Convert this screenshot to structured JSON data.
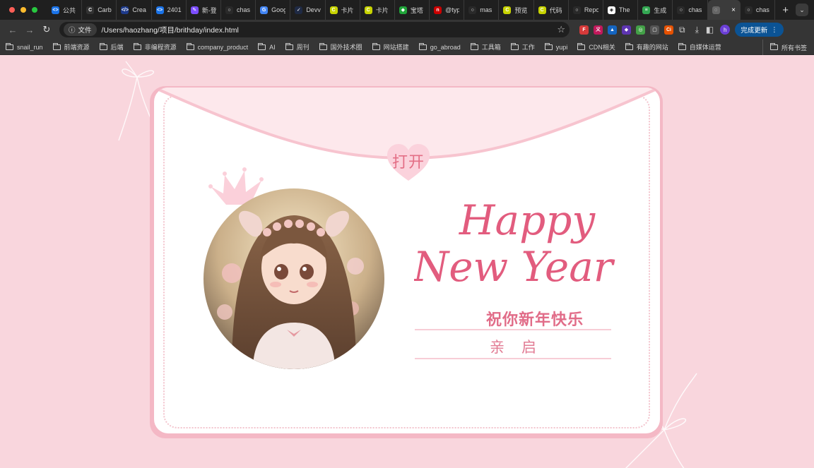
{
  "window": {
    "tabs": [
      {
        "title": "公共",
        "fav": "<>",
        "color": "#1a73e8"
      },
      {
        "title": "Carb",
        "fav": "C",
        "color": "#333333"
      },
      {
        "title": "Crea",
        "fav": "</>",
        "color": "#1e3a8a"
      },
      {
        "title": "2401",
        "fav": "<>",
        "color": "#1a73e8"
      },
      {
        "title": "新-登",
        "fav": "✎",
        "color": "#7c4dff"
      },
      {
        "title": "chas",
        "fav": "○",
        "color": "#2a2a2a"
      },
      {
        "title": "Goog",
        "fav": "G",
        "color": "#4285f4"
      },
      {
        "title": "Devv",
        "fav": "✓",
        "color": "#1f2a44"
      },
      {
        "title": "卡片",
        "fav": "C",
        "color": "#c8d400"
      },
      {
        "title": "卡片",
        "fav": "C",
        "color": "#c8d400"
      },
      {
        "title": "宝塔",
        "fav": "◆",
        "color": "#20a53a"
      },
      {
        "title": "@typ",
        "fav": "n",
        "color": "#cc0000"
      },
      {
        "title": "mas",
        "fav": "○",
        "color": "#2a2a2a"
      },
      {
        "title": "预览",
        "fav": "C",
        "color": "#c8d400"
      },
      {
        "title": "代码",
        "fav": "C",
        "color": "#c8d400"
      },
      {
        "title": "Repo",
        "fav": "○",
        "color": "#2a2a2a"
      },
      {
        "title": "The",
        "fav": "◈",
        "color": "#ffffff"
      },
      {
        "title": "生成",
        "fav": "≡",
        "color": "#34a853"
      },
      {
        "title": "chas",
        "fav": "○",
        "color": "#2a2a2a"
      },
      {
        "title": "",
        "fav": "◌",
        "color": "#666666",
        "active": true
      },
      {
        "title": "chas",
        "fav": "○",
        "color": "#2a2a2a"
      }
    ],
    "new_tab_label": "+",
    "tab_menu_label": "⌄"
  },
  "toolbar": {
    "back": "←",
    "forward": "→",
    "reload": "↻",
    "security_chip": "文件",
    "url": "/Users/haozhang/项目/brithday/index.html",
    "update_button": "完成更新",
    "avatar_letter": "h",
    "extensions": [
      {
        "label": "F",
        "color": "#d63a3a"
      },
      {
        "label": "义",
        "color": "#c2185b"
      },
      {
        "label": "▲",
        "color": "#1565c0"
      },
      {
        "label": "◆",
        "color": "#5e35b1"
      },
      {
        "label": "◎",
        "color": "#43a047"
      },
      {
        "label": "▢",
        "color": "#555555"
      },
      {
        "label": "Ci",
        "color": "#e65100"
      }
    ]
  },
  "bookmarks": {
    "items": [
      "snail_run",
      "前端资源",
      "后端",
      "非编程资源",
      "company_product",
      "AI",
      "周刊",
      "国外技术圈",
      "网站搭建",
      "go_abroad",
      "工具箱",
      "工作",
      "yupi",
      "CDN相关",
      "有趣的网站",
      "自媒体运营"
    ],
    "all_bookmarks": "所有书签"
  },
  "card": {
    "open_label": "打开",
    "greeting_line1": "Happy",
    "greeting_line2": "New Year",
    "wish": "祝你新年快乐",
    "recipient": "亲启",
    "colors": {
      "page_bg": "#f9d6dd",
      "accent": "#e25c7e",
      "heart": "#fbd2dc"
    }
  }
}
